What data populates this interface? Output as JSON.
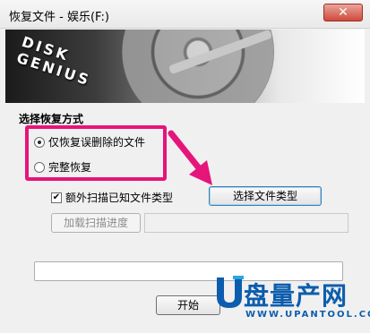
{
  "window": {
    "title": "恢复文件 - 娱乐(F:)",
    "close_label": "✕"
  },
  "banner": {
    "logo_text": "DISK GENIUS"
  },
  "recovery": {
    "group_title": "选择恢复方式",
    "options": [
      {
        "label": "仅恢复误删除的文件",
        "selected": true
      },
      {
        "label": "完整恢复",
        "selected": false
      }
    ],
    "extra_scan": {
      "label": "额外扫描已知文件类型",
      "checked": true
    },
    "choose_types_label": "选择文件类型",
    "load_progress_label": "加载扫描进度",
    "path_value": "",
    "start_label": "开始"
  },
  "watermark": {
    "brand": "盘量产网",
    "url": "WWW.UPANTOOL.COM"
  },
  "colors": {
    "highlight": "#e5157a",
    "arrow": "#e5157a",
    "watermark": "#0c5dad"
  }
}
